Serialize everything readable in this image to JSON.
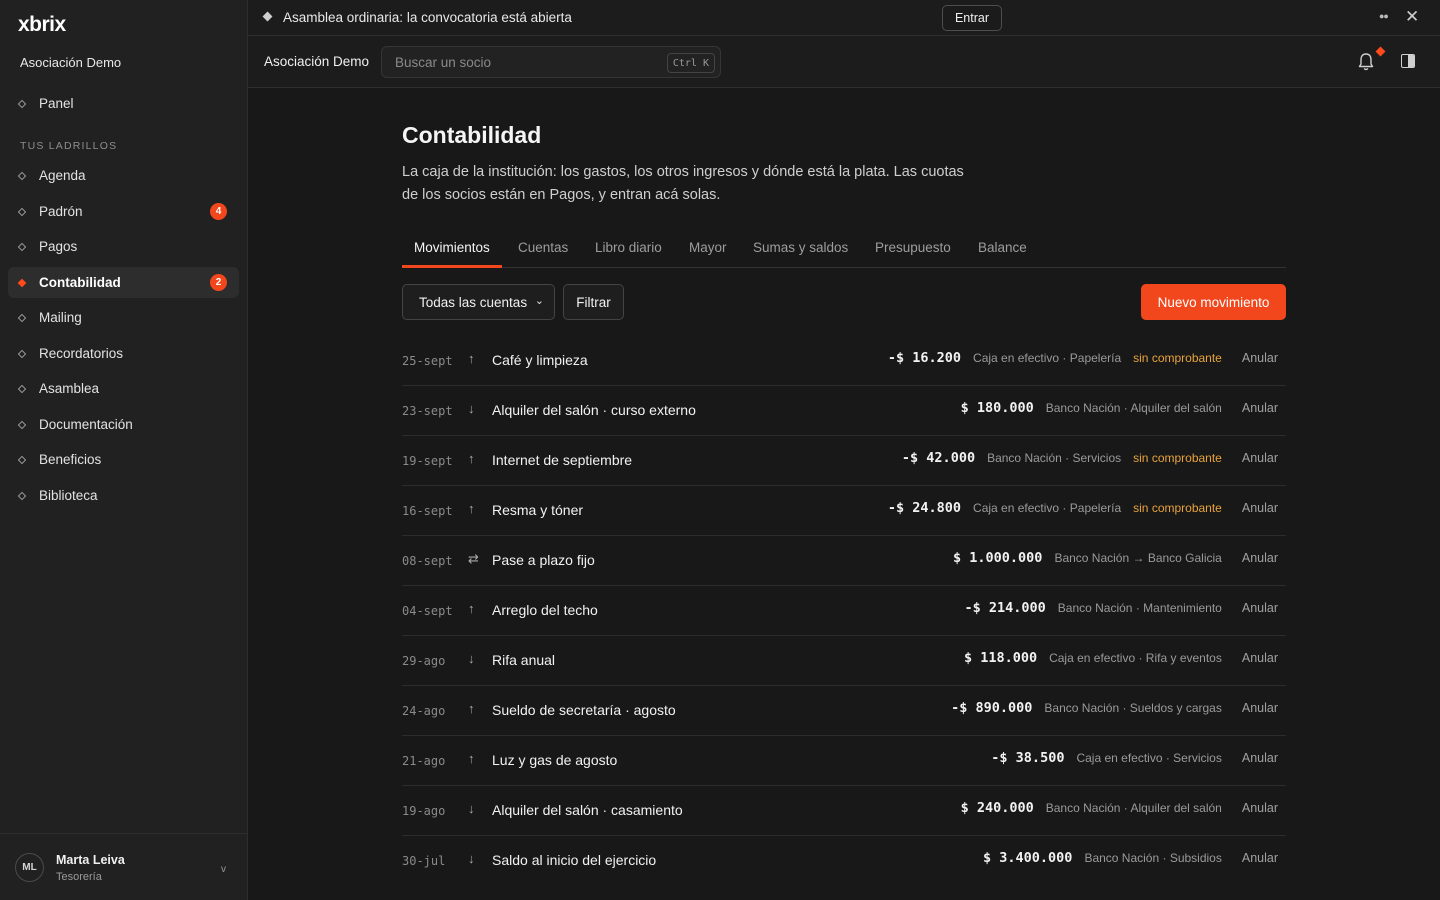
{
  "sidebar": {
    "logo": "xbrix",
    "org_name": "Asociación Demo",
    "panel_label": "Panel",
    "section_label": "TUS LADRILLOS",
    "items": [
      {
        "label": "Agenda"
      },
      {
        "label": "Padrón",
        "badge": "4"
      },
      {
        "label": "Pagos"
      },
      {
        "label": "Contabilidad",
        "badge": "2",
        "active": true
      },
      {
        "label": "Mailing"
      },
      {
        "label": "Recordatorios"
      },
      {
        "label": "Asamblea"
      },
      {
        "label": "Documentación"
      },
      {
        "label": "Beneficios"
      },
      {
        "label": "Biblioteca"
      }
    ],
    "user": {
      "initials": "ML",
      "name": "Marta Leiva",
      "role": "Tesorería",
      "chevron": "v"
    }
  },
  "banner": {
    "text": "Asamblea ordinaria: la convocatoria está abierta",
    "button": "Entrar",
    "dots": "●●",
    "close": "✕"
  },
  "header": {
    "org": "Asociación Demo",
    "search_placeholder": "Buscar un socio",
    "search_shortcut": "Ctrl K"
  },
  "main": {
    "title": "Contabilidad",
    "description": "La caja de la institución: los gastos, los otros ingresos y dónde está la plata. Las cuotas de los socios están en Pagos, y entran acá solas.",
    "tabs": [
      "Movimientos",
      "Cuentas",
      "Libro diario",
      "Mayor",
      "Sumas y saldos",
      "Presupuesto",
      "Balance"
    ],
    "active_tab": "Movimientos",
    "filter_select": "Todas las cuentas",
    "filter_button": "Filtrar",
    "new_button": "Nuevo movimiento",
    "void_label": "Anular",
    "movements": [
      {
        "date": "25-sept",
        "dir": "↑",
        "concept": "Café y limpieza",
        "amount": "-$ 16.200",
        "meta": "Caja en efectivo · Papelería",
        "warn": "sin comprobante"
      },
      {
        "date": "23-sept",
        "dir": "↓",
        "concept": "Alquiler del salón · curso externo",
        "amount": "$ 180.000",
        "meta": "Banco Nación · Alquiler del salón",
        "warn": ""
      },
      {
        "date": "19-sept",
        "dir": "↑",
        "concept": "Internet de septiembre",
        "amount": "-$ 42.000",
        "meta": "Banco Nación · Servicios",
        "warn": "sin comprobante"
      },
      {
        "date": "16-sept",
        "dir": "↑",
        "concept": "Resma y tóner",
        "amount": "-$ 24.800",
        "meta": "Caja en efectivo · Papelería",
        "warn": "sin comprobante"
      },
      {
        "date": "08-sept",
        "dir": "⇄",
        "concept": "Pase a plazo fijo",
        "amount": "$ 1.000.000",
        "meta": "Banco Nación → Banco Galicia",
        "warn": ""
      },
      {
        "date": "04-sept",
        "dir": "↑",
        "concept": "Arreglo del techo",
        "amount": "-$ 214.000",
        "meta": "Banco Nación · Mantenimiento",
        "warn": ""
      },
      {
        "date": "29-ago",
        "dir": "↓",
        "concept": "Rifa anual",
        "amount": "$ 118.000",
        "meta": "Caja en efectivo · Rifa y eventos",
        "warn": ""
      },
      {
        "date": "24-ago",
        "dir": "↑",
        "concept": "Sueldo de secretaría · agosto",
        "amount": "-$ 890.000",
        "meta": "Banco Nación · Sueldos y cargas",
        "warn": ""
      },
      {
        "date": "21-ago",
        "dir": "↑",
        "concept": "Luz y gas de agosto",
        "amount": "-$ 38.500",
        "meta": "Caja en efectivo · Servicios",
        "warn": ""
      },
      {
        "date": "19-ago",
        "dir": "↓",
        "concept": "Alquiler del salón · casamiento",
        "amount": "$ 240.000",
        "meta": "Banco Nación · Alquiler del salón",
        "warn": ""
      },
      {
        "date": "30-jul",
        "dir": "↓",
        "concept": "Saldo al inicio del ejercicio",
        "amount": "$ 3.400.000",
        "meta": "Banco Nación · Subsidios",
        "warn": ""
      }
    ]
  },
  "colors": {
    "accent": "#f2471c",
    "warning": "#e8a33c",
    "background": "#181818",
    "sidebar": "#212121"
  },
  "icons": {
    "bell": "bell-icon",
    "panel": "panel-toggle-icon",
    "close": "close-icon",
    "diamond": "diamond-icon"
  }
}
